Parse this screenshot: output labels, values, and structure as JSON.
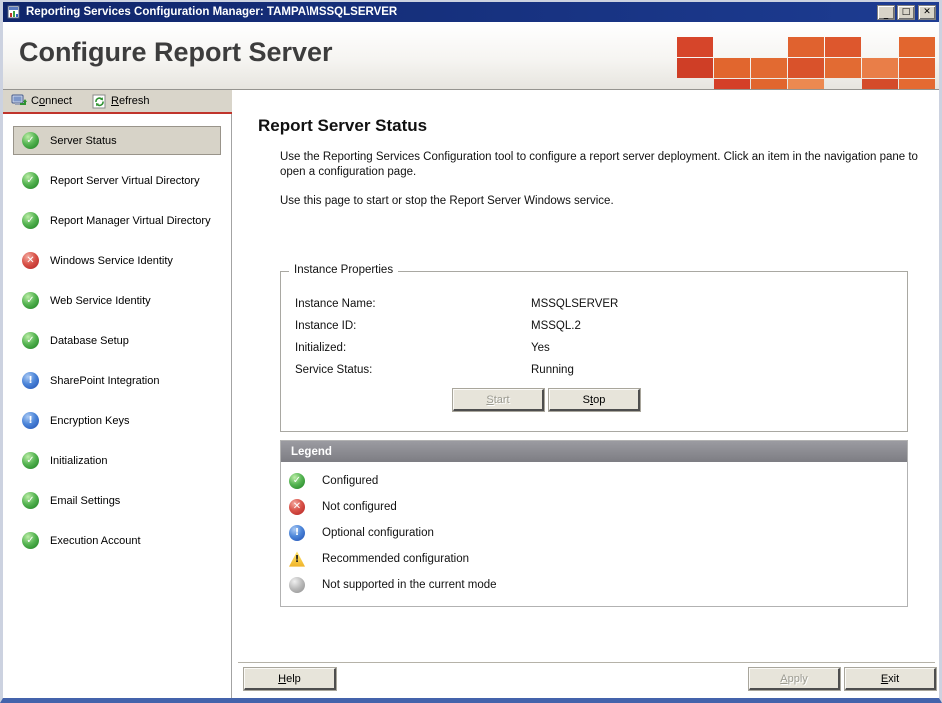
{
  "window": {
    "title": "Reporting Services Configuration Manager: TAMPA\\MSSQLSERVER",
    "controls": {
      "minimize": "_",
      "maximize": "□",
      "close": "✕"
    }
  },
  "header": {
    "title": "Configure Report Server",
    "mosaic": [
      "#d6452a",
      null,
      null,
      "#e0622f",
      "#dd572d",
      null,
      "#e2662f",
      "#cf3e26",
      "#e1662e",
      "#e26a31",
      "#d9522b",
      "#e26b33",
      "#e97e48",
      "#df602d",
      null,
      "#d43f27",
      "#e1662e",
      "#ec8950",
      null,
      "#d44b2a",
      "#e46a32"
    ]
  },
  "toolbar": {
    "connect": {
      "pre": "C",
      "key": "o",
      "post": "nnect"
    },
    "refresh": {
      "pre": "",
      "key": "R",
      "post": "efresh"
    }
  },
  "sidebar": {
    "items": [
      {
        "label": "Server Status",
        "status": "ok",
        "selected": true
      },
      {
        "label": "Report Server Virtual Directory",
        "status": "ok"
      },
      {
        "label": "Report Manager Virtual Directory",
        "status": "ok"
      },
      {
        "label": "Windows Service Identity",
        "status": "error"
      },
      {
        "label": "Web Service Identity",
        "status": "ok"
      },
      {
        "label": "Database Setup",
        "status": "ok"
      },
      {
        "label": "SharePoint Integration",
        "status": "info"
      },
      {
        "label": "Encryption Keys",
        "status": "info"
      },
      {
        "label": "Initialization",
        "status": "ok"
      },
      {
        "label": "Email Settings",
        "status": "ok"
      },
      {
        "label": "Execution Account",
        "status": "ok"
      }
    ]
  },
  "main": {
    "title": "Report Server Status",
    "intro1": "Use the Reporting Services Configuration tool to configure a report server deployment. Click an item in the navigation pane to open a configuration page.",
    "intro2": "Use this page to start or stop the Report Server Windows service.",
    "instance_properties": {
      "title": "Instance Properties",
      "fields": [
        {
          "label": "Instance Name:",
          "value": "MSSQLSERVER"
        },
        {
          "label": "Instance ID:",
          "value": "MSSQL.2"
        },
        {
          "label": "Initialized:",
          "value": "Yes"
        },
        {
          "label": "Service Status:",
          "value": "Running"
        }
      ],
      "start": {
        "pre": "",
        "key": "S",
        "post": "tart"
      },
      "stop": {
        "pre": "S",
        "key": "t",
        "post": "op"
      }
    },
    "legend": {
      "title": "Legend",
      "items": [
        {
          "label": "Configured",
          "status": "ok"
        },
        {
          "label": "Not configured",
          "status": "error"
        },
        {
          "label": "Optional configuration",
          "status": "info"
        },
        {
          "label": "Recommended configuration",
          "status": "warning"
        },
        {
          "label": "Not supported in the current mode",
          "status": "notsupported"
        }
      ]
    }
  },
  "footer": {
    "help": {
      "pre": "",
      "key": "H",
      "post": "elp"
    },
    "apply": {
      "pre": "",
      "key": "A",
      "post": "pply"
    },
    "exit": {
      "pre": "",
      "key": "E",
      "post": "xit"
    }
  },
  "status_glyphs": {
    "ok": "✓",
    "error": "✕",
    "info": "!",
    "warning": "!",
    "notsupported": ""
  },
  "colors": {
    "title_bar": "#10266b",
    "toolbar_accent_line": "#c0342b",
    "status_ok": "#2f9231",
    "status_error": "#c03330",
    "status_info": "#2f62c0",
    "status_warning": "#f0b228",
    "status_notsupported": "#9a9a9a"
  }
}
